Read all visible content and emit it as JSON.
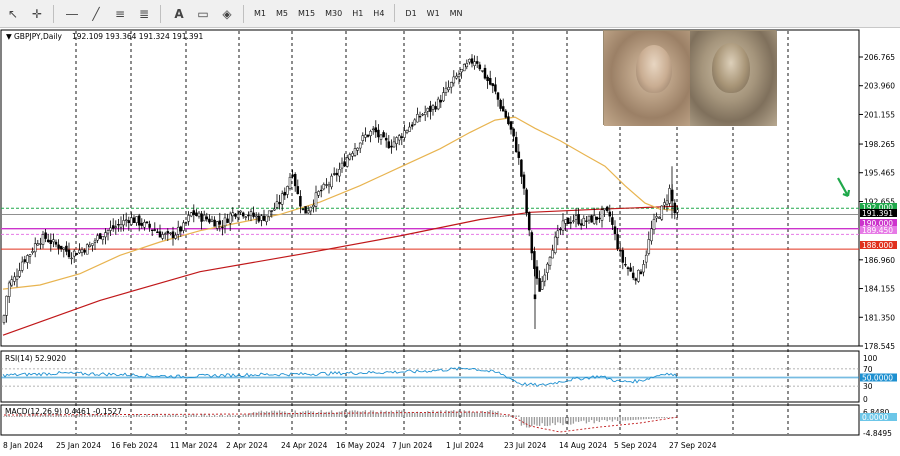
{
  "toolbar": {
    "timeframes": [
      "M1",
      "M5",
      "M15",
      "M30",
      "H1",
      "H4",
      "D1",
      "W1",
      "MN"
    ]
  },
  "chart_header": {
    "symbol": "GBPJPY,Daily",
    "ohlc": "192.109 193.364 191.324 191.391"
  },
  "price_axis": {
    "ticks": [
      "206.765",
      "203.960",
      "201.155",
      "198.265",
      "195.465",
      "192.655",
      "186.960",
      "184.155",
      "181.350",
      "178.545"
    ]
  },
  "price_tags": [
    {
      "label": "192.000",
      "color": "#1fa84a"
    },
    {
      "label": "191.391",
      "color": "#000000"
    },
    {
      "label": "190.000",
      "color": "#cc33cc"
    },
    {
      "label": "189.450",
      "color": "#e67ae6"
    },
    {
      "label": "188.000",
      "color": "#e0301e"
    }
  ],
  "rsi": {
    "label": "RSI(14) 52.9020",
    "ticks": [
      "100",
      "70",
      "30",
      "0"
    ],
    "level_tag": "50.0000"
  },
  "macd": {
    "label": "MACD(12,26,9) 0.4461 -0.1527",
    "ticks": [
      "6.8480",
      "-4.8495"
    ],
    "level_tag": "0.0000"
  },
  "dates": [
    "8 Jan 2024",
    "25 Jan 2024",
    "16 Feb 2024",
    "11 Mar 2024",
    "2 Apr 2024",
    "24 Apr 2024",
    "16 May 2024",
    "7 Jun 2024",
    "1 Jul 2024",
    "23 Jul 2024",
    "14 Aug 2024",
    "5 Sep 2024",
    "27 Sep 2024"
  ],
  "colors": {
    "bull_candle": "#ffffff",
    "bear_candle": "#000000",
    "ma_slow": "#c0181a",
    "ma_fast": "#e8b450",
    "rsi_line": "#1e90d0",
    "arrow": "#1fa84a"
  },
  "icons": [
    "cursor-icon",
    "crosshair-icon",
    "horizontal-line-icon",
    "trendline-icon",
    "fibonacci-icon",
    "text-icon",
    "label-icon",
    "shapes-icon"
  ]
}
